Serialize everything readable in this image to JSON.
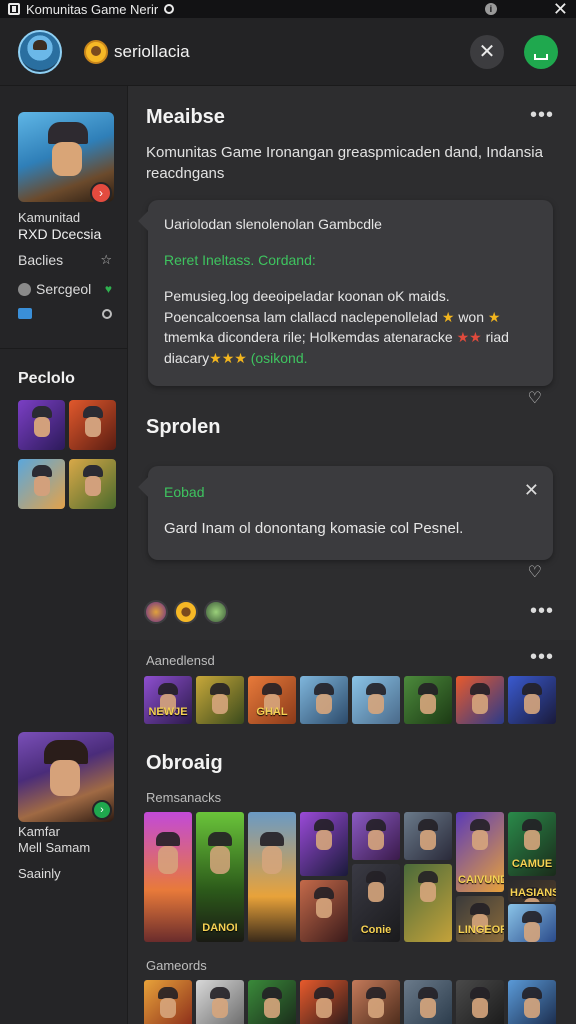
{
  "status_bar": {
    "title": "Komunitas Game Nerir"
  },
  "header": {
    "username": "seriollacia"
  },
  "sidebar": {
    "profile_line1": "Kamunitad",
    "profile_line2": "RXD Dcecsia",
    "items": [
      {
        "label": "Baclies",
        "icon": "star-icon"
      },
      {
        "label": "Sercgeol",
        "icon": "bird-icon"
      }
    ],
    "section_title": "Peclolo",
    "bottom_line1": "Kamfar",
    "bottom_line2": "Mell Samam",
    "bottom_line3": "Saainly"
  },
  "main": {
    "title": "Meaibse",
    "description": "Komunitas Game Ironangan greaspmicaden dand, Indansia reacdngans",
    "card1": {
      "title": "Uariolodan slenolenolan Gambcdle",
      "highlight": "Reret Ineltass. Cordand:",
      "body_part1": "Pemusieg.log deeoipeladar koonan oK maids. Poencalcoensa lam clallacd naclepenollelad",
      "stars_gold": "★",
      "body_part2": "won",
      "stars_gold_end": "★",
      "body_part3": "tmemka dicondera rile; Holkemdas atenaracke",
      "stars_red": "★★",
      "body_part4": "riad diacary",
      "stars_triple": "★★★",
      "highlight_end": "(osikond."
    },
    "section2_title": "Sprolen",
    "card2": {
      "highlight": "Eobad",
      "body": "Gard Inam ol donontang komasie col Pesnel."
    },
    "sub1": "Aanedlensd",
    "sub1_tiles": [
      "NEWJE",
      "",
      "GHAL",
      "",
      "",
      "",
      "",
      ""
    ],
    "section3_title": "Obroaig",
    "sub2": "Remsanacks",
    "sub2_tiles": [
      "",
      "DANOI",
      "",
      "",
      "",
      "Conie",
      "CAIVUND",
      "CAMUE",
      "",
      "",
      "",
      "LINGEOR",
      "HASIANS"
    ],
    "sub3": "Gameords"
  },
  "colors": {
    "accent_green": "#3ec45f",
    "badge_red": "#e34b3f",
    "download_green": "#1fa84e",
    "star_gold": "#f2b51e"
  }
}
